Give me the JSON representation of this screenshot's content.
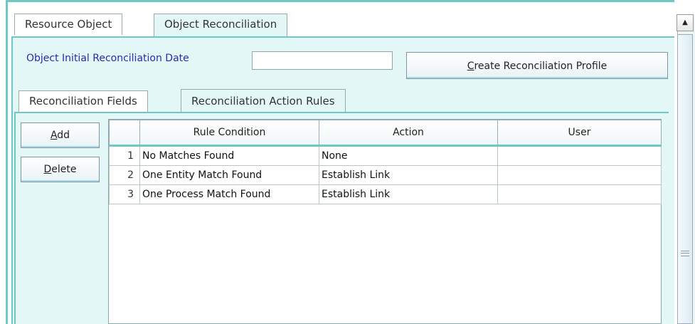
{
  "outer_tabs": [
    {
      "label": "Resource Object",
      "active": false
    },
    {
      "label": "Object Reconciliation",
      "active": true
    }
  ],
  "form": {
    "date_label": "Object Initial Reconciliation Date",
    "date_value": "",
    "create_profile_first": "C",
    "create_profile_rest": "reate Reconciliation Profile"
  },
  "inner_tabs": [
    {
      "label": "Reconciliation Fields",
      "active": false
    },
    {
      "label": "Reconciliation Action Rules",
      "active": true
    }
  ],
  "buttons": {
    "add_first": "A",
    "add_rest": "dd",
    "delete_first": "D",
    "delete_rest": "elete"
  },
  "table": {
    "headers": [
      "",
      "Rule Condition",
      "Action",
      "User"
    ],
    "rows": [
      [
        "1",
        "No Matches Found",
        "None",
        ""
      ],
      [
        "2",
        "One Entity Match Found",
        "Establish Link",
        ""
      ],
      [
        "3",
        "One Process Match Found",
        "Establish Link",
        ""
      ]
    ]
  },
  "scrollbar": {
    "up_icon": "arrow-up-icon",
    "grip_icon": "grip-icon"
  },
  "colors": {
    "accent": "#6fc7c8",
    "panel": "#e4f7f7",
    "label_blue": "#2a2ab0"
  }
}
